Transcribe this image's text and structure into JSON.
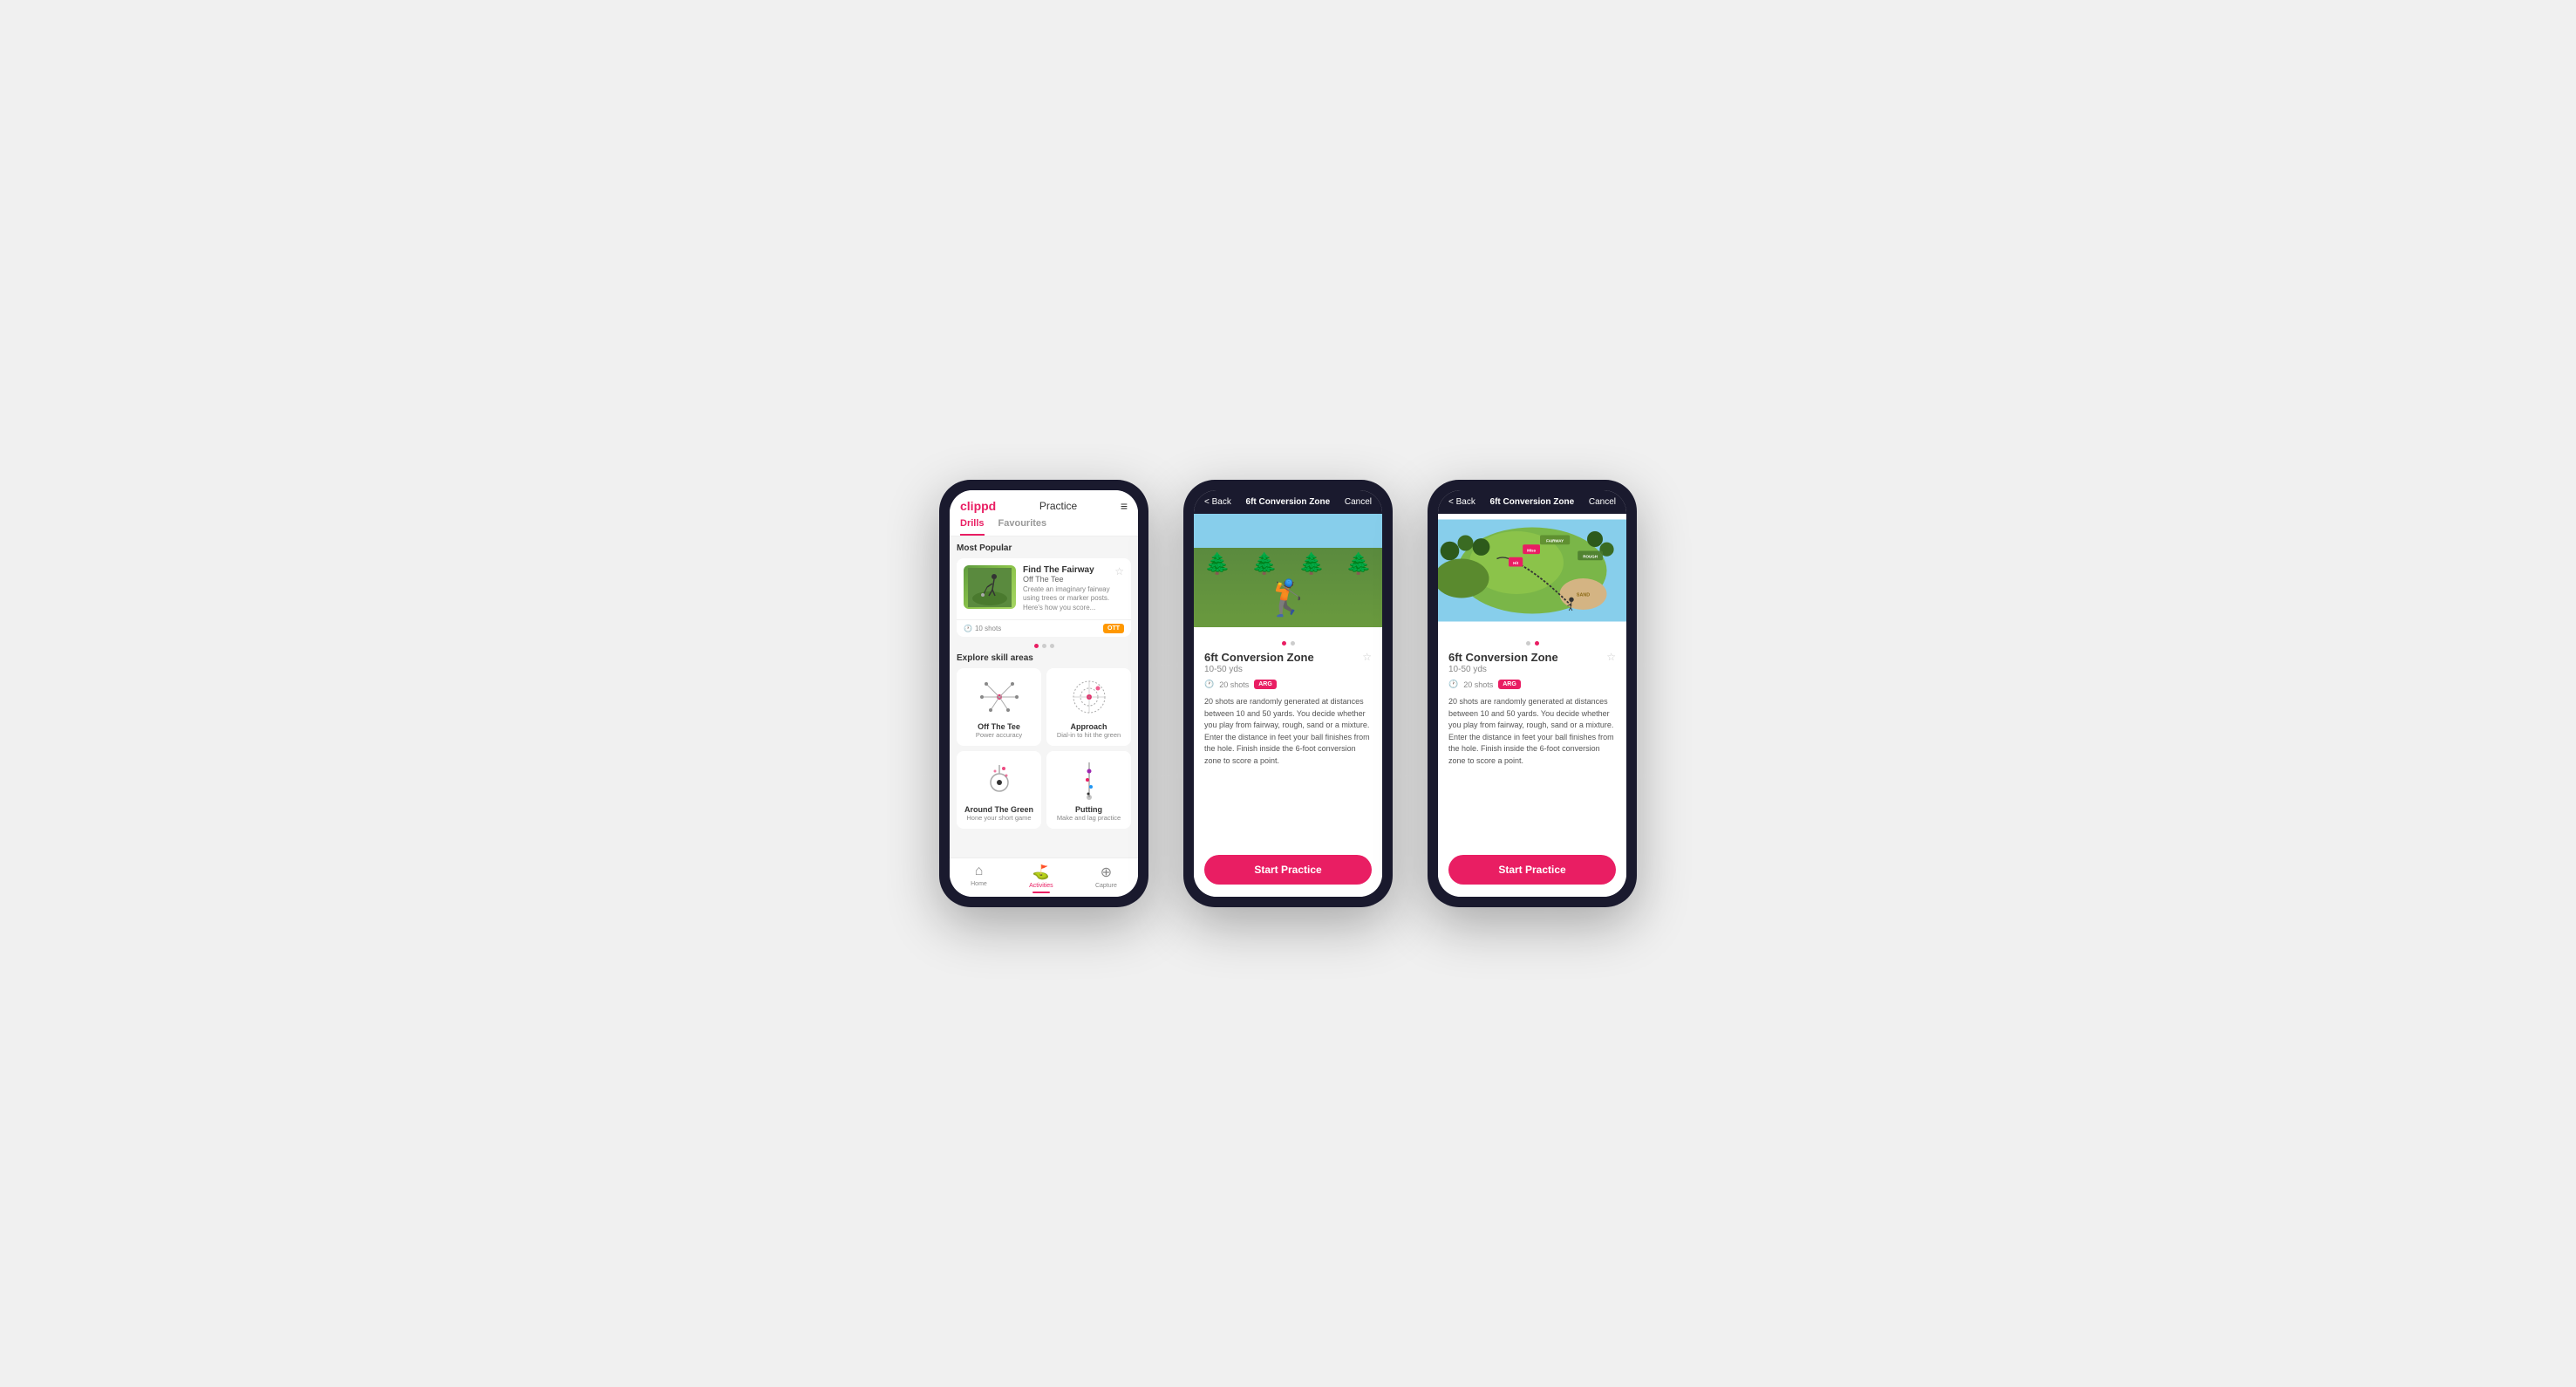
{
  "app": {
    "name": "clippd"
  },
  "phone1": {
    "header": {
      "logo": "clippd",
      "center_title": "Practice",
      "menu_icon": "≡"
    },
    "tabs": [
      "Drills",
      "Favourites"
    ],
    "active_tab": 0,
    "most_popular_label": "Most Popular",
    "featured_drill": {
      "title": "Find The Fairway",
      "subtitle": "Off The Tee",
      "description": "Create an imaginary fairway using trees or marker posts. Here's how you score...",
      "shots": "10 shots",
      "badge": "OTT"
    },
    "dots": [
      true,
      false,
      false
    ],
    "explore_label": "Explore skill areas",
    "skills": [
      {
        "name": "Off The Tee",
        "desc": "Power accuracy",
        "icon": "ott"
      },
      {
        "name": "Approach",
        "desc": "Dial-in to hit the green",
        "icon": "approach"
      },
      {
        "name": "Around The Green",
        "desc": "Hone your short game",
        "icon": "atg"
      },
      {
        "name": "Putting",
        "desc": "Make and lag practice",
        "icon": "putting"
      }
    ],
    "nav": [
      {
        "label": "Home",
        "icon": "⌂",
        "active": false
      },
      {
        "label": "Activities",
        "icon": "⛳",
        "active": true
      },
      {
        "label": "Capture",
        "icon": "⊕",
        "active": false
      }
    ]
  },
  "phone2": {
    "header": {
      "back_label": "< Back",
      "title": "6ft Conversion Zone",
      "cancel_label": "Cancel"
    },
    "drill": {
      "name": "6ft Conversion Zone",
      "range": "10-50 yds",
      "shots": "20 shots",
      "badge": "ARG",
      "description": "20 shots are randomly generated at distances between 10 and 50 yards. You decide whether you play from fairway, rough, sand or a mixture. Enter the distance in feet your ball finishes from the hole. Finish inside the 6-foot conversion zone to score a point.",
      "favorite": false
    },
    "image_dots": [
      true,
      false
    ],
    "start_btn_label": "Start Practice"
  },
  "phone3": {
    "header": {
      "back_label": "< Back",
      "title": "6ft Conversion Zone",
      "cancel_label": "Cancel"
    },
    "drill": {
      "name": "6ft Conversion Zone",
      "range": "10-50 yds",
      "shots": "20 shots",
      "badge": "ARG",
      "description": "20 shots are randomly generated at distances between 10 and 50 yards. You decide whether you play from fairway, rough, sand or a mixture. Enter the distance in feet your ball finishes from the hole. Finish inside the 6-foot conversion zone to score a point.",
      "favorite": false
    },
    "image_dots": [
      false,
      true
    ],
    "start_btn_label": "Start Practice",
    "map_labels": {
      "fairway": "FAIRWAY",
      "rough": "ROUGH",
      "miss": "Miss",
      "hit": "Hit",
      "sand": "SAND"
    }
  }
}
